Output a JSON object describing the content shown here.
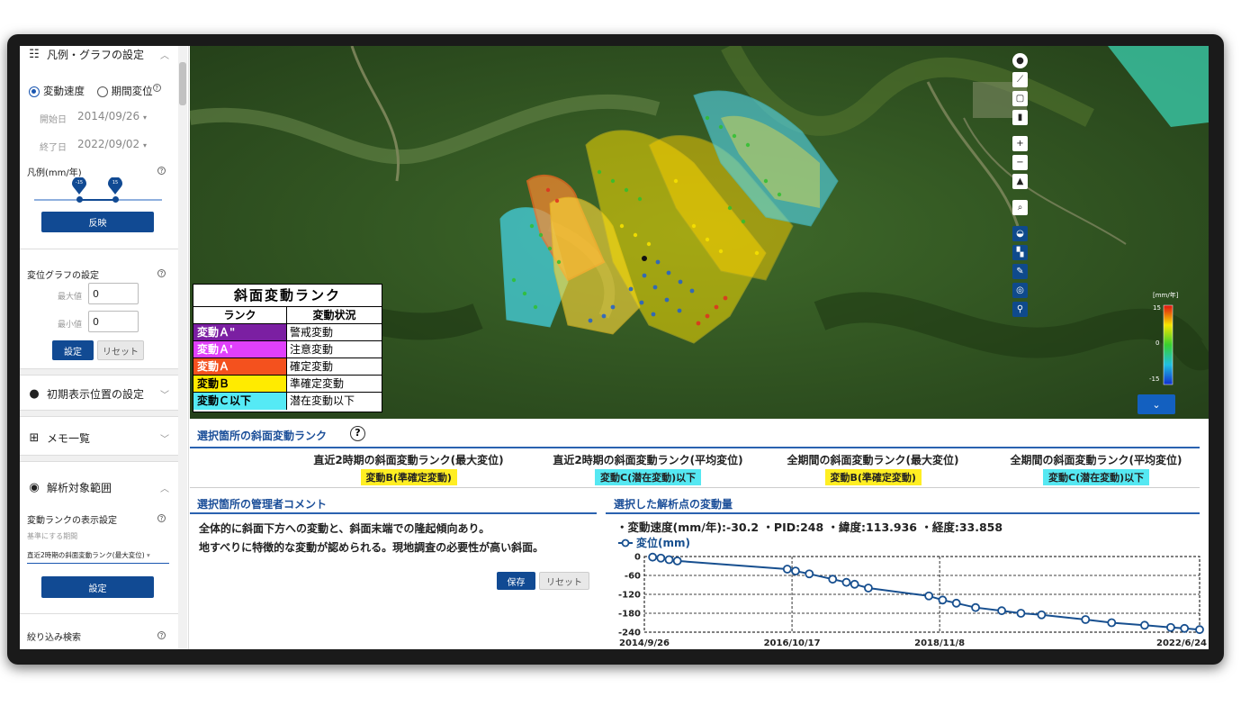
{
  "sidebar": {
    "legend_section": {
      "title": "凡例・グラフの設定"
    },
    "radio_speed": "変動速度",
    "radio_period": "期間変位",
    "start_label": "開始日",
    "start_value": "2014/09/26",
    "end_label": "終了日",
    "end_value": "2022/09/02",
    "legend_unit_label": "凡例(mm/年)",
    "slider": {
      "min_handle": "-15",
      "max_handle": "15"
    },
    "apply_button": "反映",
    "graph_settings_title": "変位グラフの設定",
    "max_label": "最大値",
    "max_value": "0",
    "min_label": "最小値",
    "min_value": "0",
    "set_button": "設定",
    "reset_button": "リセット",
    "initial_position_title": "初期表示位置の設定",
    "memo_title": "メモ一覧",
    "analysis_title": "解析対象範囲",
    "rank_display_title": "変動ランクの表示設定",
    "basis_label": "基準にする期間",
    "basis_value": "直近2時期の斜面変動ランク(最大変位)",
    "set_button2": "設定",
    "filter_title": "絞り込み検索"
  },
  "map": {
    "colorbar": {
      "unit": "[mm/年]",
      "top": "15",
      "mid": "0",
      "bottom": "-15"
    }
  },
  "legend_table": {
    "title": "斜面変動ランク",
    "col1": "ランク",
    "col2": "変動状況",
    "rows": [
      {
        "rank": "変動Ａ\"",
        "status": "警戒変動",
        "color": "#7b1fa2",
        "text_color": "#ffffff"
      },
      {
        "rank": "変動Ａ'",
        "status": "注意変動",
        "color": "#e040fb",
        "text_color": "#ffffff"
      },
      {
        "rank": "変動Ａ",
        "status": "確定変動",
        "color": "#f4511e",
        "text_color": "#ffffff"
      },
      {
        "rank": "変動Ｂ",
        "status": "準確定変動",
        "color": "#ffeb00",
        "text_color": "#000000"
      },
      {
        "rank": "変動Ｃ以下",
        "status": "潜在変動以下",
        "color": "#55eaf5",
        "text_color": "#000000"
      }
    ]
  },
  "rank_panel": {
    "title": "選択箇所の斜面変動ランク",
    "items": [
      {
        "heading": "直近2時期の斜面変動ランク(最大変位)",
        "value": "変動B(準確定変動)",
        "color": "#ffee22"
      },
      {
        "heading": "直近2時期の斜面変動ランク(平均変位)",
        "value": "変動C(潜在変動)以下",
        "color": "#55e8f2"
      },
      {
        "heading": "全期間の斜面変動ランク(最大変位)",
        "value": "変動B(準確定変動)",
        "color": "#ffee22"
      },
      {
        "heading": "全期間の斜面変動ランク(平均変位)",
        "value": "変動C(潜在変動)以下",
        "color": "#55e8f2"
      }
    ]
  },
  "comment_panel": {
    "title": "選択箇所の管理者コメント",
    "line1": "全体的に斜面下方への変動と、斜面末端での隆起傾向あり。",
    "line2": "地すべりに特徴的な変動が認められる。現地調査の必要性が高い斜面。",
    "save_button": "保存",
    "reset_button": "リセット"
  },
  "displacement_panel": {
    "title": "選択した解析点の変動量",
    "stats": "・変動速度(mm/年):-30.2 ・PID:248 ・緯度:113.936 ・経度:33.858"
  },
  "chart_data": {
    "type": "line",
    "series": [
      {
        "name": "変位(mm)",
        "color": "#174f8f",
        "points": [
          [
            "2014-11-07",
            -2
          ],
          [
            "2014-12-19",
            -5
          ],
          [
            "2015-01-30",
            -10
          ],
          [
            "2015-03-13",
            -14
          ],
          [
            "2016-09-23",
            -40
          ],
          [
            "2016-11-04",
            -46
          ],
          [
            "2017-01-13",
            -55
          ],
          [
            "2017-05-12",
            -72
          ],
          [
            "2017-07-21",
            -82
          ],
          [
            "2017-09-01",
            -88
          ],
          [
            "2017-11-10",
            -100
          ],
          [
            "2018-09-14",
            -125
          ],
          [
            "2018-11-23",
            -138
          ],
          [
            "2019-02-01",
            -148
          ],
          [
            "2019-05-10",
            -162
          ],
          [
            "2019-09-20",
            -172
          ],
          [
            "2019-12-27",
            -180
          ],
          [
            "2020-04-10",
            -185
          ],
          [
            "2020-11-20",
            -200
          ],
          [
            "2021-04-02",
            -210
          ],
          [
            "2021-09-17",
            -218
          ],
          [
            "2022-01-28",
            -225
          ],
          [
            "2022-04-08",
            -228
          ],
          [
            "2022-06-24",
            -232
          ]
        ]
      }
    ],
    "x_ticks": [
      "2014/9/26",
      "2016/10/17",
      "2018/11/8",
      "2022/6/24"
    ],
    "x_range": [
      "2014-09-26",
      "2022-06-24"
    ],
    "y_ticks": [
      "0",
      "-60",
      "-120",
      "-180",
      "-240"
    ],
    "ylim": [
      -240,
      0
    ],
    "legend": "top-left",
    "grid": "dashed"
  }
}
